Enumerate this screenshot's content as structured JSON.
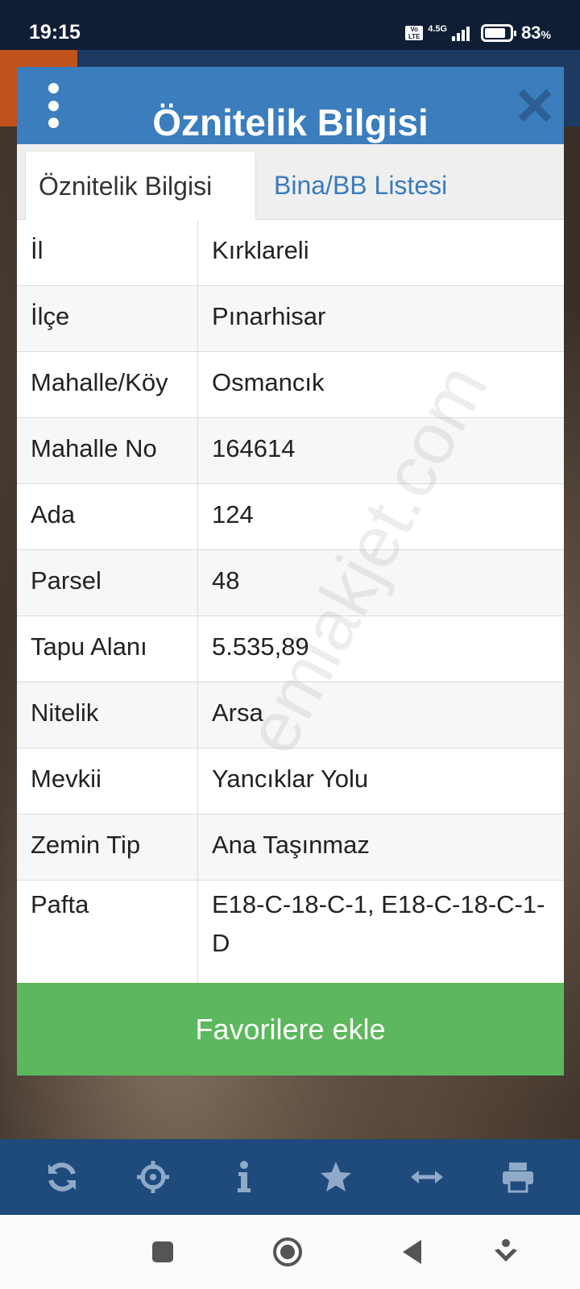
{
  "status_bar": {
    "time": "19:15",
    "volte": "Vo LTE",
    "network": "4.5G",
    "battery_percent_value": 83,
    "battery_text": "83",
    "battery_unit": "%"
  },
  "dialog": {
    "title": "Öznitelik Bilgisi",
    "tabs": [
      {
        "label": "Öznitelik Bilgisi",
        "active": true
      },
      {
        "label": "Bina/BB Listesi",
        "active": false
      }
    ],
    "rows": [
      {
        "key": "İl",
        "value": "Kırklareli"
      },
      {
        "key": "İlçe",
        "value": "Pınarhisar"
      },
      {
        "key": "Mahalle/Köy",
        "value": "Osmancık"
      },
      {
        "key": "Mahalle No",
        "value": "164614"
      },
      {
        "key": "Ada",
        "value": "124"
      },
      {
        "key": "Parsel",
        "value": "48"
      },
      {
        "key": "Tapu Alanı",
        "value": "5.535,89"
      },
      {
        "key": "Nitelik",
        "value": "Arsa"
      },
      {
        "key": "Mevkii",
        "value": "Yancıklar Yolu"
      },
      {
        "key": "Zemin Tip",
        "value": "Ana Taşınmaz"
      },
      {
        "key": "Pafta",
        "value": "E18-C-18-C-1,    E18-C-18-C-1-D"
      }
    ],
    "favorite_button": "Favorilere ekle"
  },
  "watermark": "emlakjet.com",
  "toolbar": {
    "icons": [
      "refresh-icon",
      "crosshair-icon",
      "info-icon",
      "star-icon",
      "arrows-horizontal-icon",
      "printer-icon"
    ]
  },
  "colors": {
    "header": "#3b7dbd",
    "tab_link": "#3a7bbf",
    "button": "#5cb85c",
    "toolbar": "#1e4a7c",
    "status_bar": "#0f1e35"
  }
}
